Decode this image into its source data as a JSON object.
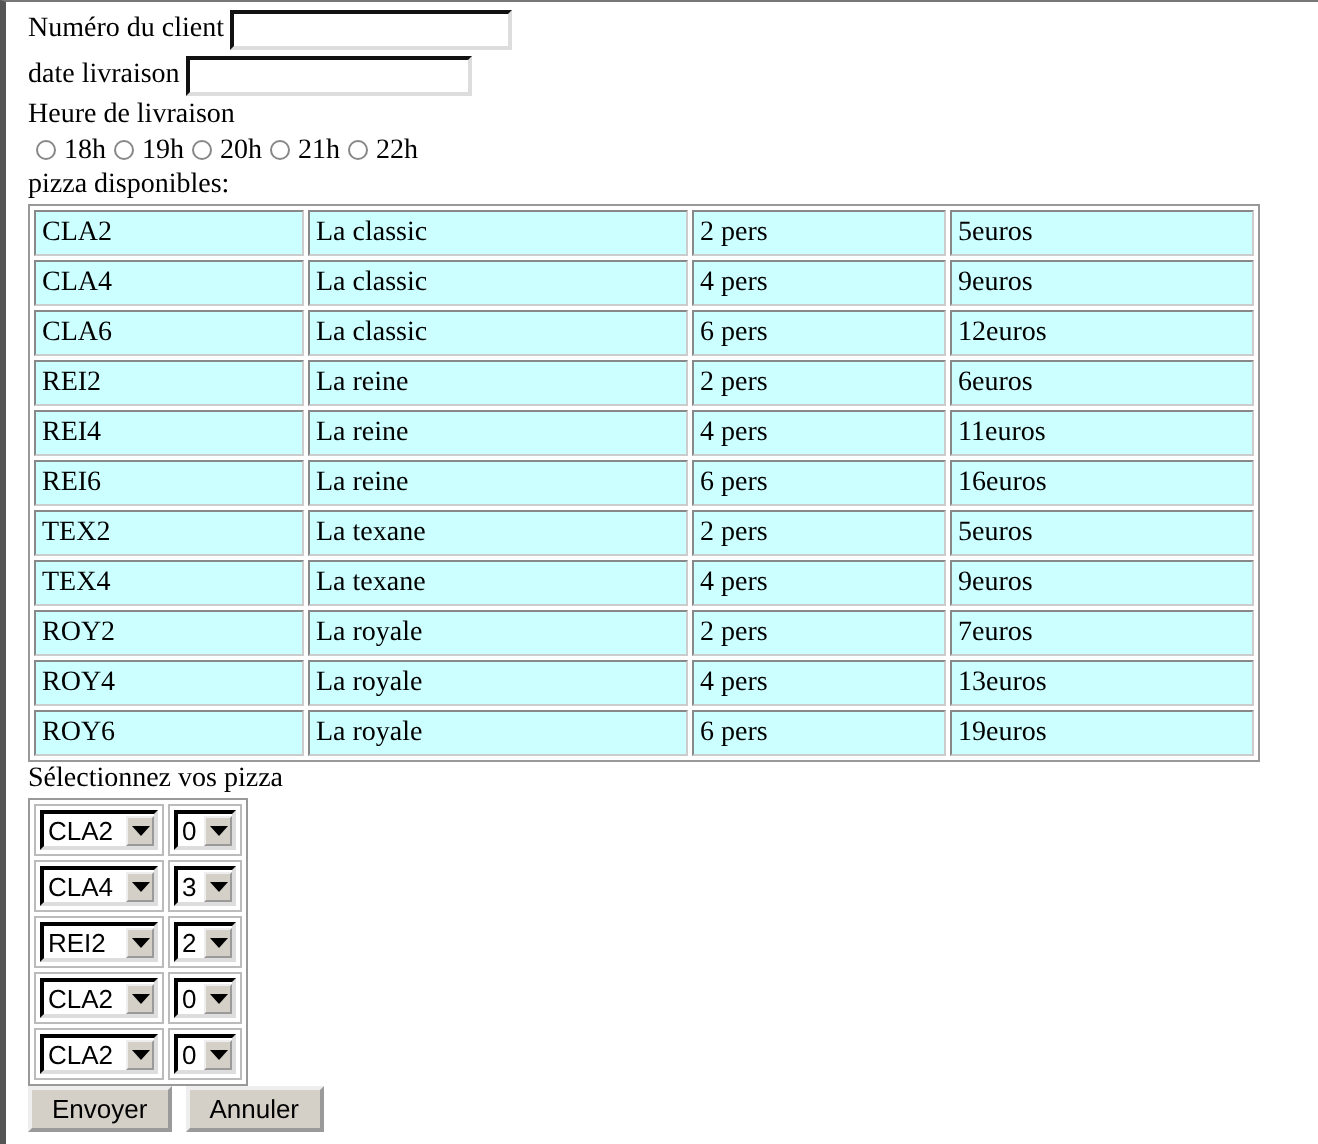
{
  "fields": [
    {
      "label": "Numéro du client"
    },
    {
      "label": "date livraison"
    }
  ],
  "delivery_time": {
    "label": "Heure de livraison",
    "options": [
      {
        "label": "18h",
        "selected": false
      },
      {
        "label": "19h",
        "selected": false
      },
      {
        "label": "20h",
        "selected": false
      },
      {
        "label": "21h",
        "selected": false
      },
      {
        "label": "22h",
        "selected": false
      }
    ]
  },
  "pizza_table": {
    "caption": "pizza disponibles:",
    "rows": [
      [
        "CLA2",
        "La classic",
        "2 pers",
        "5euros"
      ],
      [
        "CLA4",
        "La classic",
        "4 pers",
        "9euros"
      ],
      [
        "CLA6",
        "La classic",
        "6 pers",
        "12euros"
      ],
      [
        "REI2",
        "La reine",
        "2 pers",
        "6euros"
      ],
      [
        "REI4",
        "La reine",
        "4 pers",
        "11euros"
      ],
      [
        "REI6",
        "La reine",
        "6 pers",
        "16euros"
      ],
      [
        "TEX2",
        "La texane",
        "2 pers",
        "5euros"
      ],
      [
        "TEX4",
        "La texane",
        "4 pers",
        "9euros"
      ],
      [
        "ROY2",
        "La royale",
        "2 pers",
        "7euros"
      ],
      [
        "ROY4",
        "La royale",
        "4 pers",
        "13euros"
      ],
      [
        "ROY6",
        "La royale",
        "6 pers",
        "19euros"
      ]
    ]
  },
  "selection": {
    "label": "Sélectionnez vos pizza",
    "rows": [
      {
        "pizza": "CLA2",
        "quantity": "0"
      },
      {
        "pizza": "CLA4",
        "quantity": "3"
      },
      {
        "pizza": "REI2",
        "quantity": "2"
      },
      {
        "pizza": "CLA2",
        "quantity": "0"
      },
      {
        "pizza": "CLA2",
        "quantity": "0"
      }
    ]
  },
  "buttons": [
    "Envoyer",
    "Annuler"
  ]
}
